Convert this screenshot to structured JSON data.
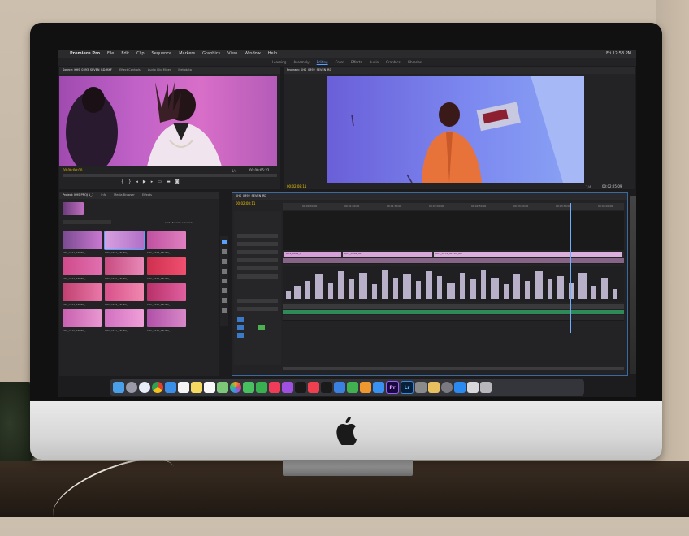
{
  "menubar": {
    "app_name": "Premiere Pro",
    "items": [
      "File",
      "Edit",
      "Clip",
      "Sequence",
      "Markers",
      "Graphics",
      "View",
      "Window",
      "Help"
    ],
    "clock": "Fri 12:58 PM"
  },
  "workspaces": {
    "items": [
      "Learning",
      "Assembly",
      "Editing",
      "Color",
      "Effects",
      "Audio",
      "Graphics",
      "Libraries"
    ],
    "active": "Editing"
  },
  "source_monitor": {
    "tab": "Source: KHS_0393_SEVEN_RD.MXF",
    "tabs_other": [
      "Effect Controls",
      "Audio Clip Mixer",
      "Metadata"
    ],
    "timecode_in": "00:00:00:00",
    "timecode_out": "00:00:05:22",
    "fit": "1/4"
  },
  "program_monitor": {
    "tab": "Program: KHS_0392_SEVEN_RD",
    "timecode_in": "00:02:08:11",
    "timecode_out": "00:02:25:09",
    "fit": "1/4"
  },
  "project_panel": {
    "tab": "Project: KHS PROJ 1_1",
    "tabs_other": [
      "Info",
      "Media Browser",
      "Effects"
    ],
    "item_count": "1 of 18 items selected",
    "clip_rows": [
      [
        "KHS_0361_SEVEN_...",
        "KHS_0362_SEVEN_...",
        "KHS_0363_SEVEN_..."
      ],
      [
        "KHS_0364_SEVEN_...",
        "KHS_0365_SEVEN_...",
        "KHS_0366_SEVEN_..."
      ],
      [
        "KHS_0367_SEVEN_...",
        "KHS_0368_SEVEN_...",
        "KHS_0369_SEVEN_..."
      ],
      [
        "KHS_0370_SEVEN_...",
        "KHS_0371_SEVEN_...",
        "KHS_0372_SEVEN_..."
      ]
    ]
  },
  "timeline": {
    "tab": "KHS_0392_SEVEN_RD",
    "timecode": "00:02:08:11",
    "clips_v1": [
      "KHS_0361_S",
      "KHS_0364_SEV",
      "KHS_0372_SEVEN_RD"
    ],
    "ruler_marks": [
      "00:00:30:00",
      "00:01:00:00",
      "00:01:30:00",
      "00:02:00:00",
      "00:02:30:00",
      "00:03:00:00",
      "00:03:30:00",
      "00:04:00:00"
    ]
  },
  "dock": {
    "icons": [
      "finder-icon",
      "launchpad-icon",
      "safari-icon",
      "chrome-icon",
      "mail-icon",
      "calendar-icon",
      "notes-icon",
      "reminders-icon",
      "maps-icon",
      "photos-icon",
      "messages-icon",
      "facetime-icon",
      "music-icon",
      "podcasts-icon",
      "tv-icon",
      "news-icon",
      "stocks-icon",
      "keynote-icon",
      "numbers-icon",
      "pages-icon",
      "appstore-icon",
      "premiere-icon",
      "lightroom-icon",
      "photoshop-icon",
      "preview-icon",
      "system-prefs-icon",
      "zoom-icon",
      "downloads-icon",
      "trash-icon"
    ],
    "premiere_label": "Pr",
    "lightroom_label": "Lr"
  },
  "colors": {
    "accent_blue": "#5aa0ff",
    "timecode_yellow": "#f2c200",
    "clip_pink": "#d8a0d8",
    "audio_green": "#2f8a5a"
  }
}
